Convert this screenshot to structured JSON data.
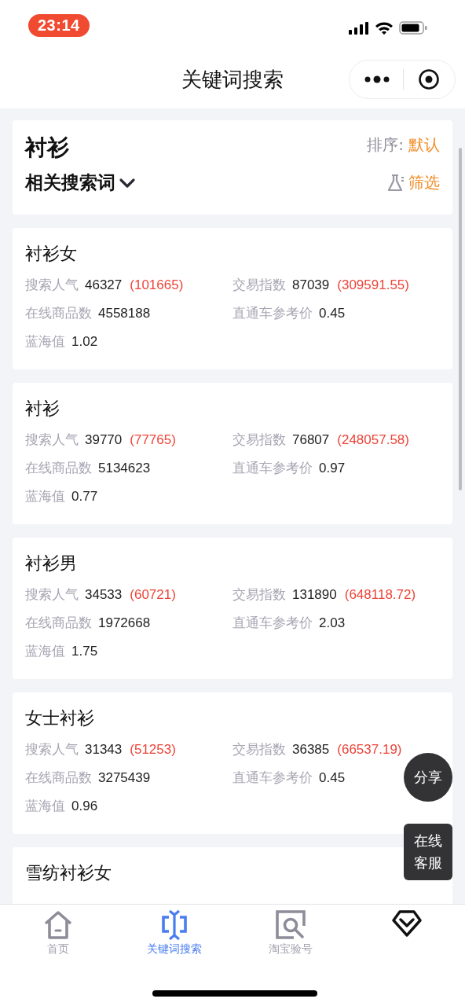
{
  "status_bar": {
    "time": "23:14"
  },
  "nav_bar": {
    "title": "关键词搜索"
  },
  "header": {
    "keyword": "衬衫",
    "sort_label": "排序:",
    "sort_value": "默认",
    "related_label": "相关搜索词",
    "filter_label": "筛选"
  },
  "results": [
    {
      "name": "衬衫女",
      "popularity_label": "搜索人气",
      "popularity": "46327",
      "popularity_extra": "(101665)",
      "trade_label": "交易指数",
      "trade": "87039",
      "trade_extra": "(309591.55)",
      "goods_label": "在线商品数",
      "goods": "4558188",
      "price_label": "直通车参考价",
      "price": "0.45",
      "blue_label": "蓝海值",
      "blue": "1.02"
    },
    {
      "name": "衬衫",
      "popularity_label": "搜索人气",
      "popularity": "39770",
      "popularity_extra": "(77765)",
      "trade_label": "交易指数",
      "trade": "76807",
      "trade_extra": "(248057.58)",
      "goods_label": "在线商品数",
      "goods": "5134623",
      "price_label": "直通车参考价",
      "price": "0.97",
      "blue_label": "蓝海值",
      "blue": "0.77"
    },
    {
      "name": "衬衫男",
      "popularity_label": "搜索人气",
      "popularity": "34533",
      "popularity_extra": "(60721)",
      "trade_label": "交易指数",
      "trade": "131890",
      "trade_extra": "(648118.72)",
      "goods_label": "在线商品数",
      "goods": "1972668",
      "price_label": "直通车参考价",
      "price": "2.03",
      "blue_label": "蓝海值",
      "blue": "1.75"
    },
    {
      "name": "女士衬衫",
      "popularity_label": "搜索人气",
      "popularity": "31343",
      "popularity_extra": "(51253)",
      "trade_label": "交易指数",
      "trade": "36385",
      "trade_extra": "(66537.19)",
      "goods_label": "在线商品数",
      "goods": "3275439",
      "price_label": "直通车参考价",
      "price": "0.45",
      "blue_label": "蓝海值",
      "blue": "0.96"
    },
    {
      "name": "雪纺衬衫女"
    }
  ],
  "floating": {
    "share": "分享",
    "service": "在线客服"
  },
  "tab_bar": [
    {
      "kind": "home",
      "label": "首页",
      "selected": false
    },
    {
      "kind": "keyword",
      "label": "关键词搜索",
      "selected": true
    },
    {
      "kind": "verify",
      "label": "淘宝验号",
      "selected": false
    },
    {
      "kind": "diamond",
      "selected": false
    }
  ]
}
